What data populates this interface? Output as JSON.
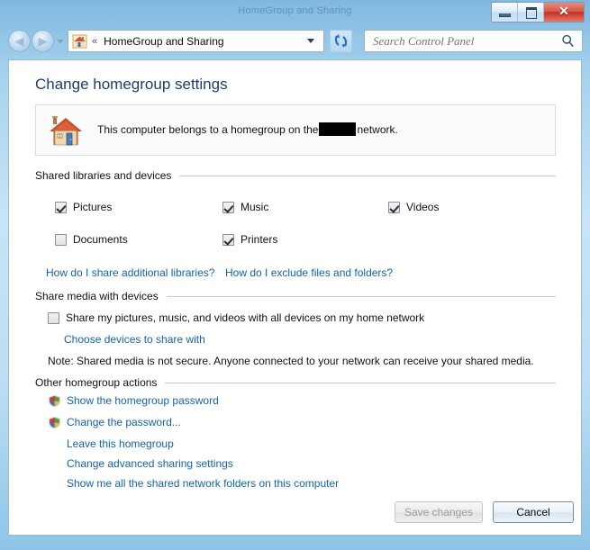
{
  "window": {
    "title": "HomeGroup and Sharing",
    "controls": {
      "minimize_label": "–",
      "maximize_label": "□",
      "close_label": "✕"
    }
  },
  "nav": {
    "back_arrow": "◀",
    "forward_arrow": "▶",
    "chevrons": "«",
    "path": "HomeGroup and Sharing",
    "refresh_title": "Refresh"
  },
  "search": {
    "placeholder": "Search Control Panel",
    "value": ""
  },
  "page": {
    "title": "Change homegroup settings"
  },
  "info_panel": {
    "text_before": "This computer belongs to a homegroup on the",
    "text_after": "network."
  },
  "shared_libraries": {
    "header": "Shared libraries and devices",
    "items": [
      {
        "label": "Pictures",
        "checked": true
      },
      {
        "label": "Music",
        "checked": true
      },
      {
        "label": "Videos",
        "checked": true
      },
      {
        "label": "Documents",
        "checked": false
      },
      {
        "label": "Printers",
        "checked": true
      }
    ],
    "links": [
      {
        "label": "How do I share additional libraries?"
      },
      {
        "label": "How do I exclude files and folders?"
      }
    ]
  },
  "share_media": {
    "header": "Share media with devices",
    "checkbox": {
      "label": "Share my pictures, music, and videos with all devices on my home network",
      "checked": false
    },
    "choose_devices_link": "Choose devices to share with",
    "note": "Note: Shared media is not secure. Anyone connected to your network can receive your shared media."
  },
  "other_actions": {
    "header": "Other homegroup actions",
    "items": [
      {
        "label": "Show the homegroup password",
        "shield": true
      },
      {
        "label": "Change the password...",
        "shield": true
      },
      {
        "label": "Leave this homegroup",
        "shield": false
      },
      {
        "label": "Change advanced sharing settings",
        "shield": false
      },
      {
        "label": "Show me all the shared network folders on this computer",
        "shield": false
      }
    ]
  },
  "buttons": {
    "save_label": "Save changes",
    "save_enabled": false,
    "cancel_label": "Cancel",
    "cancel_enabled": true
  },
  "colors": {
    "title_blue": "#1f3c70",
    "link_blue": "#1163ad",
    "frame_blue": "#a8d3ee",
    "close_red": "#c33225",
    "redaction": "#000000"
  }
}
